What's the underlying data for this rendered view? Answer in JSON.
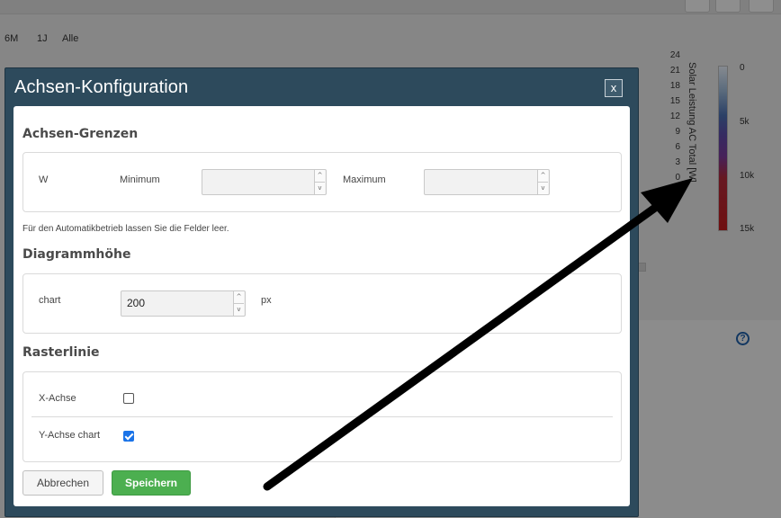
{
  "background": {
    "range_buttons": [
      "6M",
      "1J",
      "Alle"
    ],
    "axis_ticks": [
      "24",
      "21",
      "18",
      "15",
      "12",
      "9",
      "6",
      "3",
      "0"
    ],
    "axis_label": "Solar Leistung AC Total [W]",
    "colorbar_labels": [
      "0",
      "5k",
      "10k",
      "15k"
    ],
    "help_icon_text": "?"
  },
  "dialog": {
    "title": "Achsen-Konfiguration",
    "close_label": "x",
    "sections": {
      "limits": {
        "heading": "Achsen-Grenzen",
        "unit": "W",
        "min_label": "Minimum",
        "min_value": "",
        "max_label": "Maximum",
        "max_value": "",
        "hint": "Für den Automatikbetrieb lassen Sie die Felder leer."
      },
      "height": {
        "heading": "Diagrammhöhe",
        "label": "chart",
        "value": "200",
        "unit": "px"
      },
      "gridlines": {
        "heading": "Rasterlinie",
        "x_label": "X-Achse",
        "x_checked": false,
        "y_label": "Y-Achse chart",
        "y_checked": true
      }
    },
    "buttons": {
      "cancel": "Abbrechen",
      "save": "Speichern"
    }
  },
  "colors": {
    "dialog_header": "#2d4a5c",
    "save_button": "#4caf50",
    "checkbox_checked": "#1a73e8",
    "annotation_arrow": "#000000"
  }
}
